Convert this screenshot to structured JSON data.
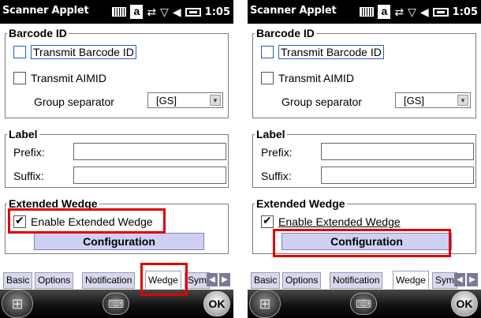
{
  "panels": [
    {
      "status": {
        "app_title": "Scanner Applet",
        "keyboard_badge": "a",
        "time": "1:05"
      },
      "barcode_group": {
        "title": "Barcode ID",
        "transmit_barcode_id": "Transmit Barcode ID",
        "transmit_aimid": "Transmit AIMID",
        "group_separator_label": "Group separator",
        "group_separator_value": "[GS]"
      },
      "label_group": {
        "title": "Label",
        "prefix_label": "Prefix:",
        "suffix_label": "Suffix:"
      },
      "ext_group": {
        "title": "Extended Wedge",
        "enable_label": "Enable Extended Wedge",
        "config_button": "Configuration"
      },
      "tabs": [
        "Basic",
        "Options",
        "Notification",
        "Wedge",
        "Sym"
      ],
      "active_tab": "Wedge",
      "taskbar": {
        "ok_label": "OK"
      }
    },
    {
      "status": {
        "app_title": "Scanner Applet",
        "keyboard_badge": "a",
        "time": "1:05"
      },
      "barcode_group": {
        "title": "Barcode ID",
        "transmit_barcode_id": "Transmit Barcode ID",
        "transmit_aimid": "Transmit AIMID",
        "group_separator_label": "Group separator",
        "group_separator_value": "[GS]"
      },
      "label_group": {
        "title": "Label",
        "prefix_label": "Prefix:",
        "suffix_label": "Suffix:"
      },
      "ext_group": {
        "title": "Extended Wedge",
        "enable_label": "Enable Extended Wedge",
        "config_button": "Configuration"
      },
      "tabs": [
        "Basic",
        "Options",
        "Notification",
        "Wedge",
        "Sym"
      ],
      "active_tab": "Wedge",
      "taskbar": {
        "ok_label": "OK"
      }
    }
  ],
  "colors": {
    "highlight": "#e00000",
    "config_button": "#cfcff2",
    "tab_inactive": "#d8d8ec",
    "focus": "#2a5dc9"
  },
  "icons": {
    "status": [
      "keyboard-icon",
      "sync-icon",
      "no-signal-icon",
      "volume-icon",
      "battery-icon"
    ],
    "taskbar": [
      "windows-start-icon",
      "keyboard-icon",
      "ok-icon"
    ],
    "tabs": [
      "tab-scroll-left-icon",
      "tab-scroll-right-icon"
    ]
  }
}
